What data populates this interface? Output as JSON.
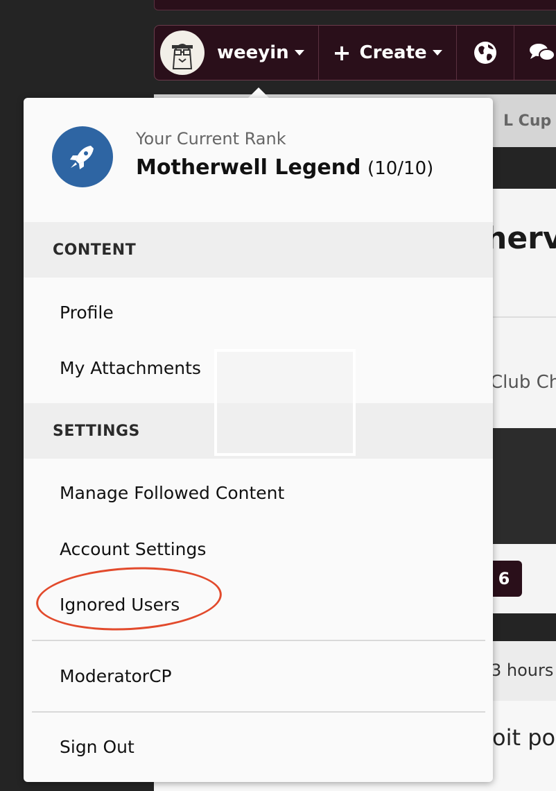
{
  "navbar": {
    "username": "weeyin",
    "create_label": "Create"
  },
  "background": {
    "tab_partial": "L Cup C",
    "title_partial": "herv",
    "club_partial": "Club Ch",
    "page_number": "6",
    "time_partial": "3 hours",
    "post_partial": "oit pon"
  },
  "rank": {
    "caption": "Your Current Rank",
    "name": "Motherwell Legend",
    "score": "(10/10)"
  },
  "menu": {
    "content_header": "CONTENT",
    "profile": "Profile",
    "attachments": "My Attachments",
    "settings_header": "SETTINGS",
    "followed": "Manage Followed Content",
    "account": "Account Settings",
    "ignored": "Ignored Users",
    "moderator": "ModeratorCP",
    "signout": "Sign Out"
  },
  "colors": {
    "navbar_bg": "#2a0f1a",
    "rank_icon_bg": "#2e65a3",
    "highlight": "#e24a2c"
  },
  "icons": [
    "user-avatar",
    "caret-down-icon",
    "plus-icon",
    "globe-icon",
    "chat-bubbles-icon",
    "rocket-icon"
  ]
}
